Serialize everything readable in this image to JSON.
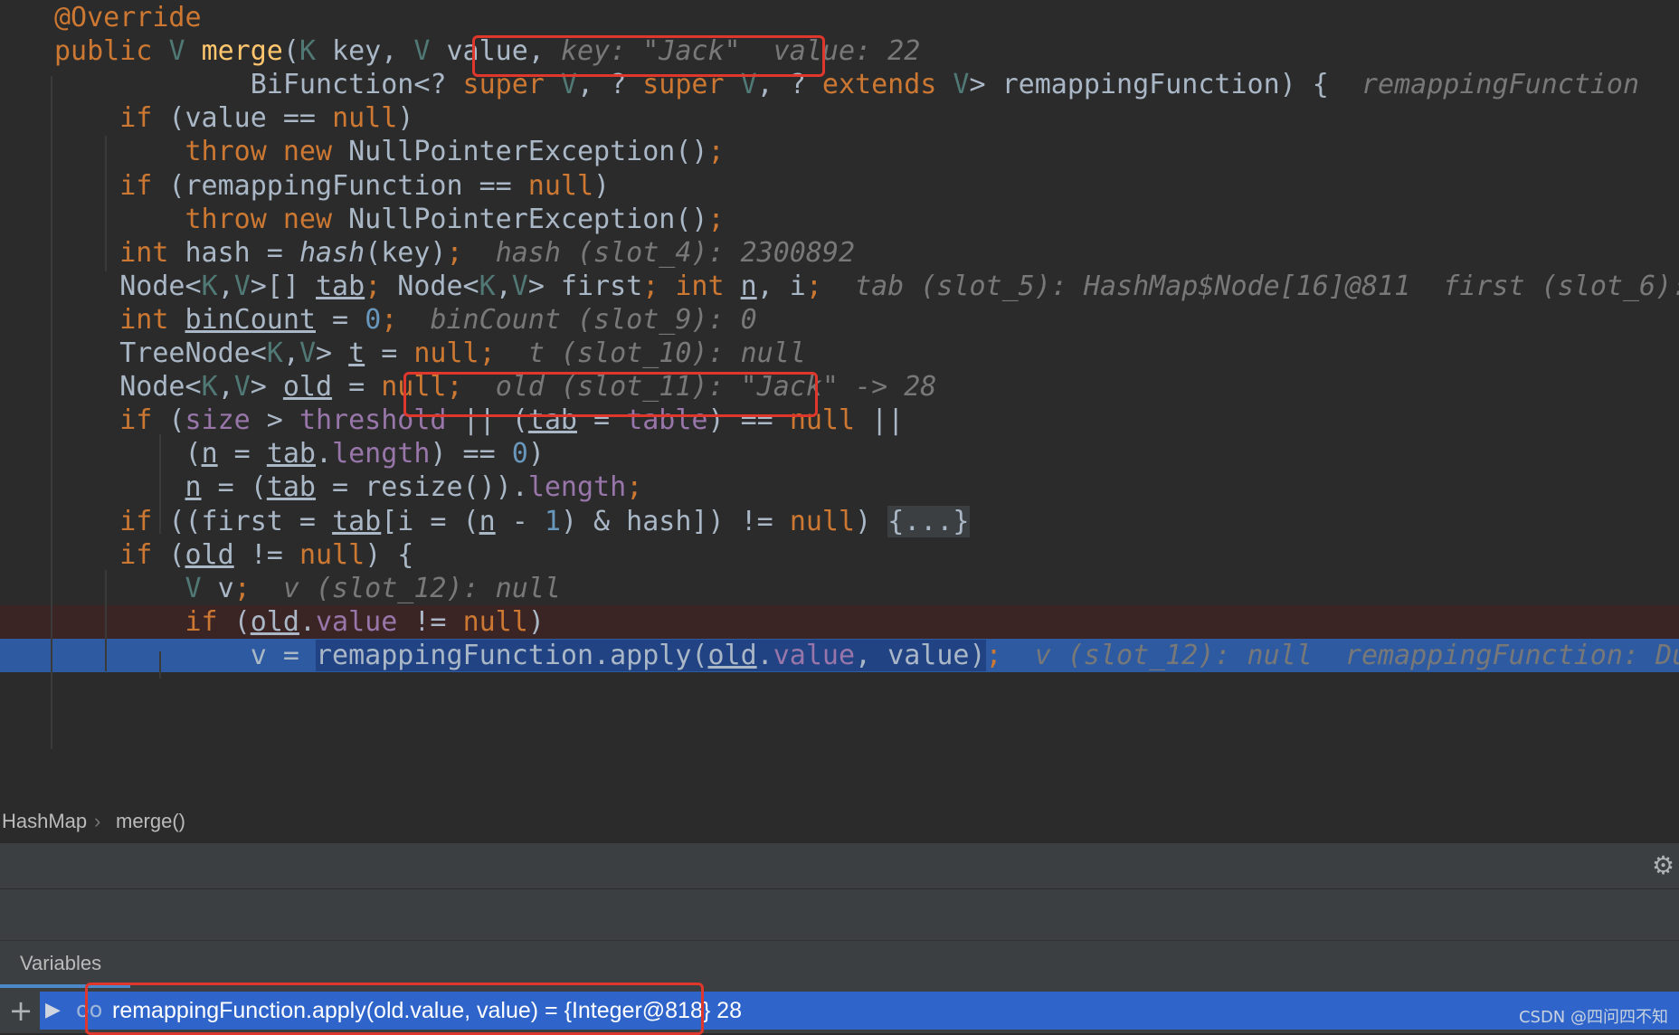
{
  "editor": {
    "lines": [
      {
        "html": "<span class='ann'>@Override</span>"
      },
      {
        "html": "<span class='kw'>public</span> <span class='tp'>V</span> <span class='fn'>merge</span>(<span class='tp'>K</span> key, <span class='tp'>V</span> value, <span class='hint'>key: \"Jack\"  value: 22</span>"
      },
      {
        "html": "            BiFunction&lt;? <span class='kw'>super</span> <span class='tp'>V</span>, ? <span class='kw'>super</span> <span class='tp'>V</span>, ? <span class='kw'>extends</span> <span class='tp'>V</span>&gt; remappingFunction) {  <span class='hint'>remappingFunction</span>"
      },
      {
        "html": "    <span class='kw'>if</span> (value == <span class='kw'>null</span>)"
      },
      {
        "html": "        <span class='kw'>throw new</span> NullPointerException()<span class='kw'>;</span>"
      },
      {
        "html": "    <span class='kw'>if</span> (remappingFunction == <span class='kw'>null</span>)"
      },
      {
        "html": "        <span class='kw'>throw new</span> NullPointerException()<span class='kw'>;</span>"
      },
      {
        "html": "    <span class='kw'>int</span> hash = <span class='it'>hash</span>(key)<span class='kw'>;</span>  <span class='hint'>hash (slot_4): 2300892</span>"
      },
      {
        "html": "    Node&lt;<span class='tp'>K</span>,<span class='tp'>V</span>&gt;[] <span class='ul'>tab</span><span class='kw'>;</span> Node&lt;<span class='tp'>K</span>,<span class='tp'>V</span>&gt; first<span class='kw'>;</span> <span class='kw'>int</span> <span class='ul'>n</span>, i<span class='kw'>;</span>  <span class='hint'>tab (slot_5): HashMap$Node[16]@811  first (slot_6):</span>"
      },
      {
        "html": "    <span class='kw'>int</span> <span class='ul'>binCount</span> = <span class='num'>0</span><span class='kw'>;</span>  <span class='hint'>binCount (slot_9): 0</span>"
      },
      {
        "html": "    TreeNode&lt;<span class='tp'>K</span>,<span class='tp'>V</span>&gt; <span class='ul'>t</span> = <span class='kw'>null;</span>  <span class='hint'>t (slot_10): null</span>"
      },
      {
        "html": "    Node&lt;<span class='tp'>K</span>,<span class='tp'>V</span>&gt; <span class='ul'>old</span> = <span class='kw'>null;</span>  <span class='hint'>old (slot_11): \"Jack\" -&gt; 28</span>"
      },
      {
        "html": "    <span class='kw'>if</span> (<span class='fld'>size</span> &gt; <span class='fld'>threshold</span> || (<span class='ul'>tab</span> = <span class='fld'>table</span>) == <span class='kw'>null</span> ||"
      },
      {
        "html": "        (<span class='ul'>n</span> = <span class='ul'>tab</span>.<span class='fld'>length</span>) == <span class='num'>0</span>)"
      },
      {
        "html": "        <span class='ul'>n</span> = (<span class='ul'>tab</span> = resize()).<span class='fld'>length</span><span class='kw'>;</span>"
      },
      {
        "html": "    <span class='kw'>if</span> ((first = <span class='ul'>tab</span>[i = (<span class='ul'>n</span> - <span class='num'>1</span>) &amp; hash]) != <span class='kw'>null</span>) <span class='fold'>{...}</span>"
      },
      {
        "html": "    <span class='kw'>if</span> (<span class='ul'>old</span> != <span class='kw'>null</span>) {"
      },
      {
        "html": "        <span class='tp'>V</span> v<span class='kw'>;</span>  <span class='hint'>v (slot_12): null</span>"
      },
      {
        "html": "        <span class='kw'>if</span> (<span class='ul'>old</span>.<span class='fld'>value</span> != <span class='kw'>null</span>)"
      },
      {
        "html": "            v = <span class='sel'>remappingFunction.apply(<span class='ul'>old</span>.<span class='fld'>value</span>, value)</span><span class='kw'>;</span>  <span class='hint'>v (slot_12): null  remappingFunction: Du</span>"
      }
    ]
  },
  "breadcrumb": {
    "class_name": "HashMap",
    "separator": "›",
    "method_name": "merge()"
  },
  "debug_toolbar": {
    "settings_icon": "gear-icon"
  },
  "variables_panel": {
    "tab_label": "Variables",
    "add_icon": "+",
    "expand_icon": "▶",
    "watch_icon": "oo",
    "watch_expression": "remappingFunction.apply(old.value, value) = {Integer@818} 28"
  },
  "watermark": "CSDN @四问四不知",
  "highlights": {
    "color": "#e0372c"
  }
}
